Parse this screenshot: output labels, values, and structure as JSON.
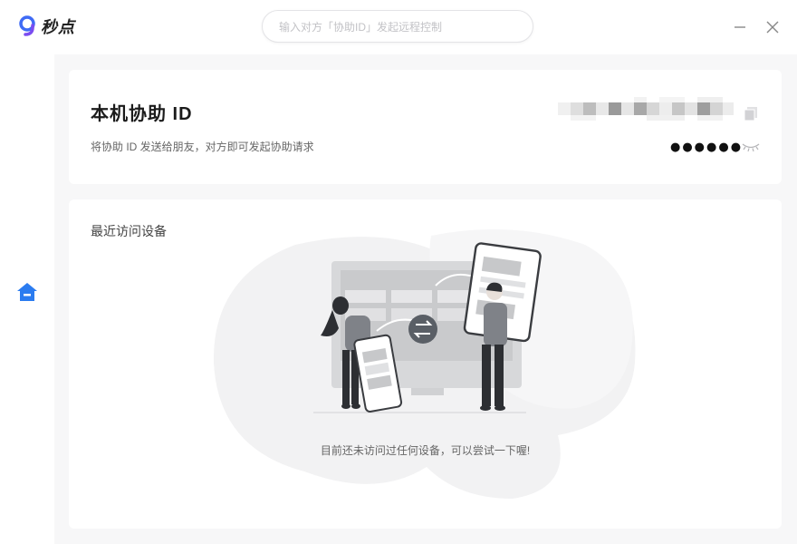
{
  "app": {
    "name": "秒点",
    "brand_color": "#3f6bf5"
  },
  "search": {
    "placeholder": "输入对方「协助ID」发起远程控制",
    "value": ""
  },
  "window_controls": {
    "minimize_icon": "minimize-icon",
    "close_icon": "close-icon"
  },
  "sidebar": {
    "items": [
      {
        "icon": "home-icon",
        "active": true,
        "color": "#2b7cf0"
      }
    ]
  },
  "id_card": {
    "title": "本机协助 ID",
    "description": "将协助 ID 发送给朋友，对方即可发起协助请求",
    "id_value_state": "blurred",
    "password_masked": "●●●●●●",
    "copy_icon": "copy-icon",
    "toggle_icon": "eye-closed-icon"
  },
  "recent": {
    "title": "最近访问设备",
    "empty_message": "目前还未访问过任何设备，可以尝试一下喔!",
    "illustration": "remote-connect-illustration"
  }
}
